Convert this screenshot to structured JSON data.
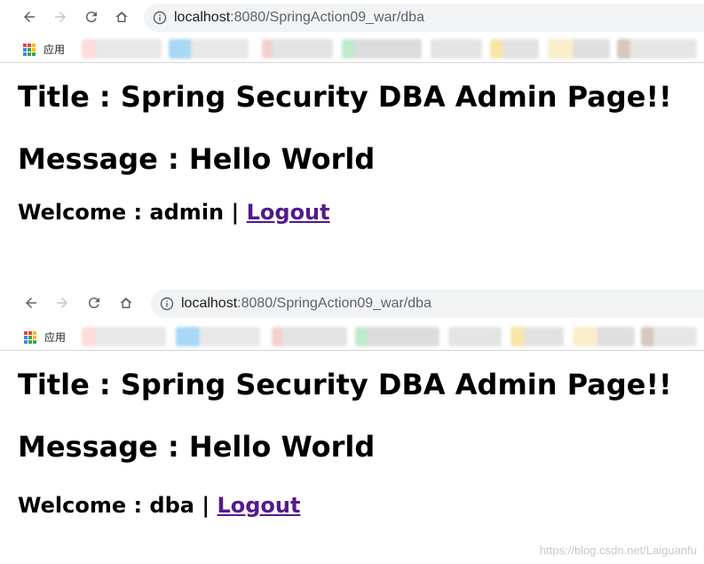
{
  "screenshots": [
    {
      "browser": {
        "url_host": "localhost",
        "url_path": ":8080/SpringAction09_war/dba",
        "apps_label": "应用"
      },
      "page": {
        "title": "Title : Spring Security DBA Admin Page!!",
        "message": "Message : Hello World",
        "welcome": "Welcome : admin | ",
        "logout_label": "Logout"
      }
    },
    {
      "browser": {
        "url_host": "localhost",
        "url_path": ":8080/SpringAction09_war/dba",
        "apps_label": "应用"
      },
      "page": {
        "title": "Title : Spring Security DBA Admin Page!!",
        "message": "Message : Hello World",
        "welcome": "Welcome : dba | ",
        "logout_label": "Logout"
      }
    }
  ],
  "watermark": "https://blog.csdn.net/Laiguanfu",
  "colors": {
    "link_visited": "#551a8b",
    "omnibox_bg": "#f1f3f4",
    "icon_gray": "#5f6368"
  },
  "icons": [
    "back-arrow-icon",
    "forward-arrow-icon",
    "reload-icon",
    "home-icon",
    "info-icon",
    "apps-grid-icon"
  ]
}
